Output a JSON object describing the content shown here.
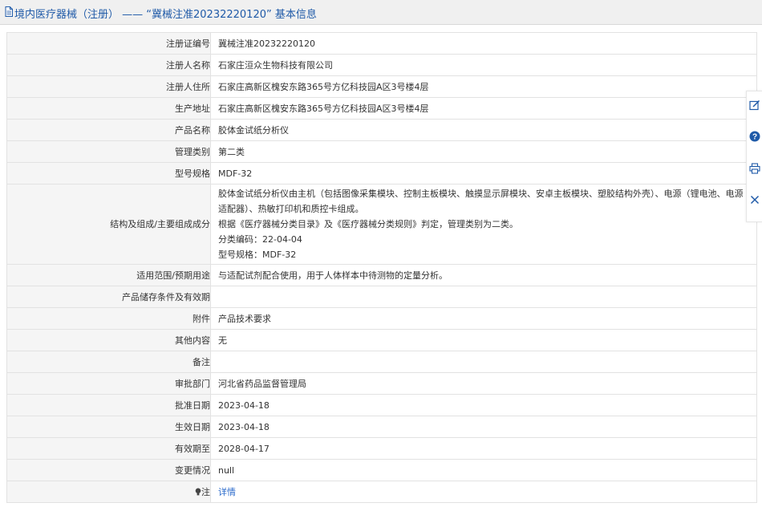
{
  "header": {
    "title": "境内医疗器械（注册） —— “冀械注准20232220120” 基本信息",
    "icon": "document-icon"
  },
  "rows": [
    {
      "label": "注册证编号",
      "value": "冀械注准20232220120"
    },
    {
      "label": "注册人名称",
      "value": "石家庄洹众生物科技有限公司"
    },
    {
      "label": "注册人住所",
      "value": "石家庄高新区槐安东路365号方亿科技园A区3号楼4层"
    },
    {
      "label": "生产地址",
      "value": "石家庄高新区槐安东路365号方亿科技园A区3号楼4层"
    },
    {
      "label": "产品名称",
      "value": "胶体金试纸分析仪"
    },
    {
      "label": "管理类别",
      "value": "第二类"
    },
    {
      "label": "型号规格",
      "value": "MDF-32"
    },
    {
      "label": "结构及组成/主要组成成分",
      "lines": [
        "胶体金试纸分析仪由主机（包括图像采集模块、控制主板模块、触摸显示屏模块、安卓主板模块、塑胶结构外壳）、电源（锂电池、电源适配器）、热敏打印机和质控卡组成。",
        "根据《医疗器械分类目录》及《医疗器械分类规则》判定，管理类别为二类。",
        "分类编码：22-04-04",
        "型号规格：MDF-32"
      ]
    },
    {
      "label": "适用范围/预期用途",
      "value": "与适配试剂配合使用，用于人体样本中待测物的定量分析。"
    },
    {
      "label": "产品储存条件及有效期",
      "value": ""
    },
    {
      "label": "附件",
      "value": "产品技术要求"
    },
    {
      "label": "其他内容",
      "value": "无"
    },
    {
      "label": "备注",
      "value": ""
    },
    {
      "label": "审批部门",
      "value": "河北省药品监督管理局"
    },
    {
      "label": "批准日期",
      "value": "2023-04-18"
    },
    {
      "label": "生效日期",
      "value": "2023-04-18"
    },
    {
      "label": "有效期至",
      "value": "2028-04-17"
    },
    {
      "label": "变更情况",
      "value": "null"
    },
    {
      "label": "注",
      "value": "详情",
      "icon": "bulb-icon"
    }
  ],
  "side_toolbar": [
    "edit-icon",
    "help-icon",
    "print-icon",
    "close-icon"
  ],
  "colors": {
    "link": "#2a6acb",
    "title": "#1f5aa8",
    "label_bg": "#f5f5f5",
    "border": "#e2e2e2"
  }
}
